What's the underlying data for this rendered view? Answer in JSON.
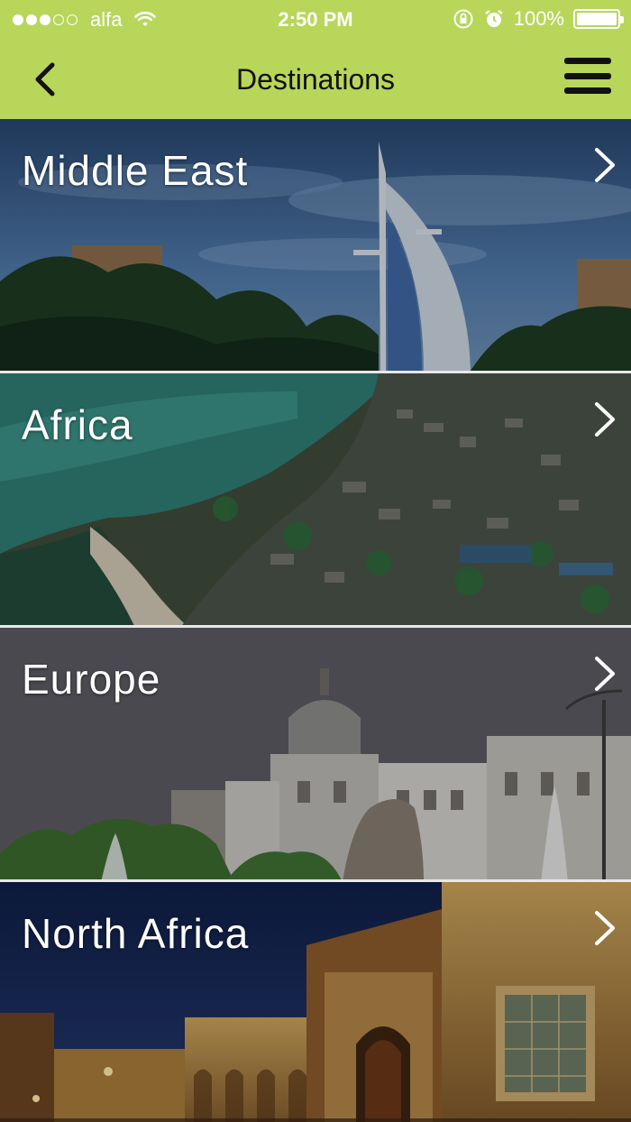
{
  "status_bar": {
    "carrier": "alfa",
    "time": "2:50 PM",
    "battery_text": "100%",
    "signal_bars": 3,
    "signal_total": 5
  },
  "nav": {
    "title": "Destinations",
    "back_icon": "chevron-left-icon",
    "menu_icon": "hamburger-menu-icon"
  },
  "destinations": [
    {
      "label": "Middle East"
    },
    {
      "label": "Africa"
    },
    {
      "label": "Europe"
    },
    {
      "label": "North Africa"
    }
  ],
  "colors": {
    "accent": "#b8d65a",
    "divider": "#e8e8e8"
  }
}
